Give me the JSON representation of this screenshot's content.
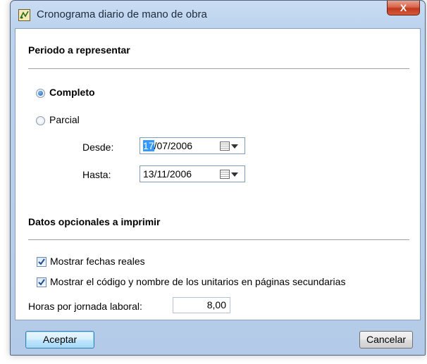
{
  "window": {
    "title": "Cronograma diario de mano de obra",
    "close_label": "X"
  },
  "period": {
    "heading": "Periodo a representar",
    "complete_label": "Completo",
    "partial_label": "Parcial",
    "selected": "Completo",
    "from_label": "Desde:",
    "from_value_selected": "17",
    "from_value_rest": "/07/2006",
    "to_label": "Hasta:",
    "to_value": "13/11/2006"
  },
  "optional": {
    "heading": "Datos opcionales a imprimir",
    "show_real_dates_label": "Mostrar fechas reales",
    "show_real_dates_checked": true,
    "show_code_label": "Mostrar el código y nombre de los unitarios en páginas secundarias",
    "show_code_checked": true,
    "hours_label": "Horas por jornada laboral:",
    "hours_value": "8,00"
  },
  "footer": {
    "accept_label": "Aceptar",
    "cancel_label": "Cancelar"
  },
  "colors": {
    "titlebar": "#bcd3ee",
    "close": "#c1391e",
    "selection": "#3399ff"
  }
}
